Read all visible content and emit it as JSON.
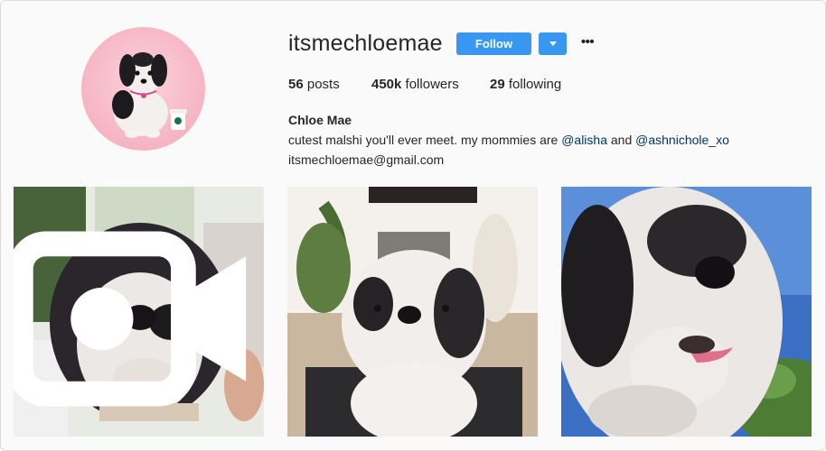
{
  "profile": {
    "username": "itsmechloemae",
    "follow_label": "Follow",
    "more_label": "•••",
    "stats": {
      "posts_count": "56",
      "posts_label": "posts",
      "followers_count": "450k",
      "followers_label": "followers",
      "following_count": "29",
      "following_label": "following"
    },
    "bio": {
      "full_name": "Chloe Mae",
      "text_before": "cutest malshi you'll ever meet. my mommies are ",
      "mention_1": "@alisha",
      "text_between": " and ",
      "mention_2": "@ashnichole_xo",
      "email": "itsmechloemae@gmail.com"
    }
  },
  "posts": [
    {
      "description_icon": "video-camera-icon",
      "is_video": true
    },
    {
      "is_video": false
    },
    {
      "is_video": false
    }
  ],
  "colors": {
    "accent": "#3897f0",
    "mention": "#003569",
    "background": "#fafafa"
  }
}
